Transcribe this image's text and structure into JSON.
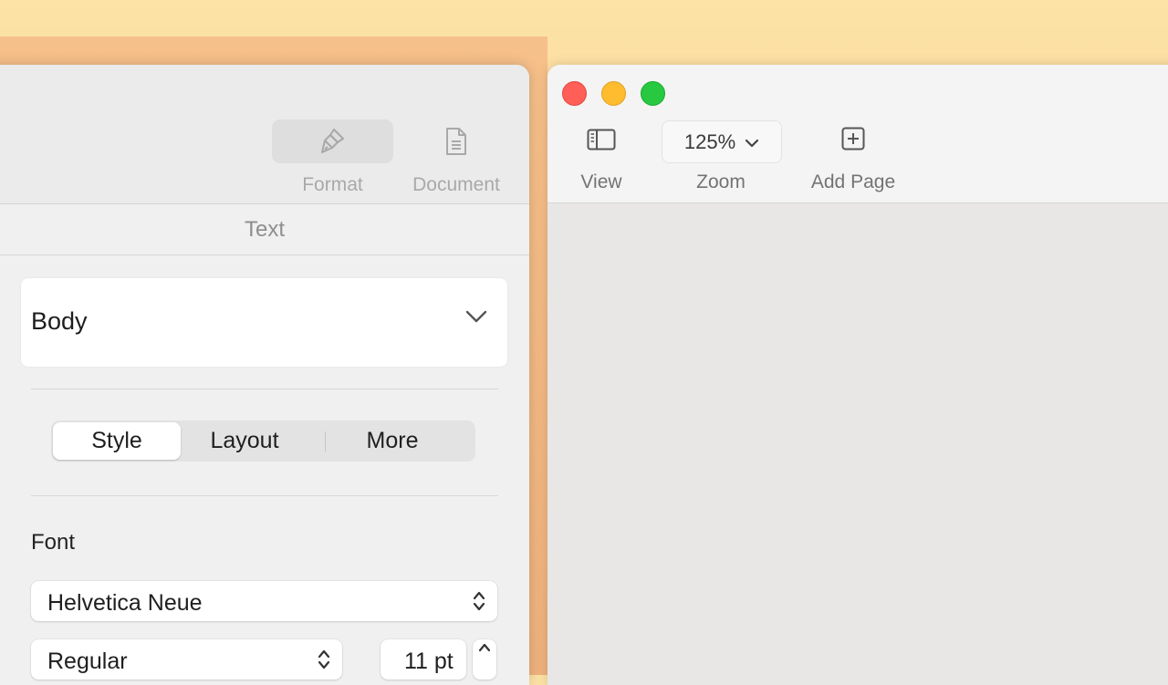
{
  "inspector": {
    "toolbar": {
      "format_label": "Format",
      "document_label": "Document"
    },
    "section_title": "Text",
    "paragraph_style": {
      "value": "Body"
    },
    "tabs": [
      {
        "label": "Style",
        "active": true
      },
      {
        "label": "Layout",
        "active": false
      },
      {
        "label": "More",
        "active": false
      }
    ],
    "font": {
      "heading": "Font",
      "family": "Helvetica Neue",
      "typeface": "Regular",
      "size": "11 pt"
    }
  },
  "document_window": {
    "toolbar": {
      "view_label": "View",
      "zoom_value": "125%",
      "zoom_label": "Zoom",
      "add_page_label": "Add Page"
    }
  },
  "colors": {
    "close": "#ff5f57",
    "minimize": "#febc2e",
    "maximize": "#28c840",
    "wallpaper": "#f9d49a"
  }
}
